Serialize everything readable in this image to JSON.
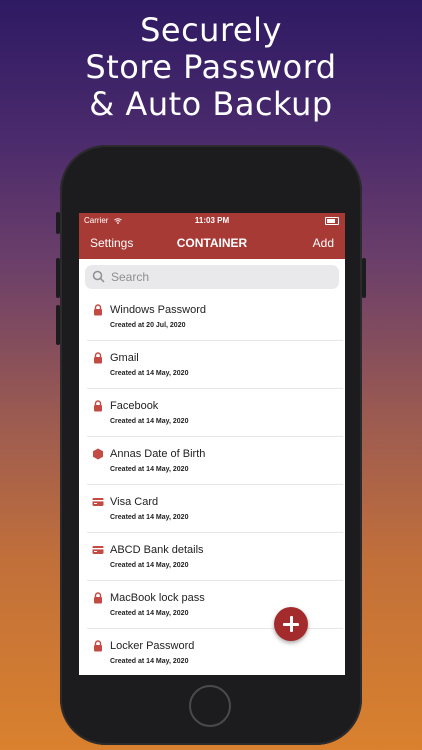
{
  "headline": {
    "line1": "Securely",
    "line2": "Store Password",
    "line3": "& Auto Backup"
  },
  "status_bar": {
    "carrier": "Carrier",
    "time": "11:03 PM"
  },
  "nav": {
    "left": "Settings",
    "title": "CONTAINER",
    "right": "Add"
  },
  "search": {
    "placeholder": "Search"
  },
  "items": [
    {
      "name": "Windows Password",
      "date": "Created at 20 Jul, 2020",
      "icon": "lock-icon"
    },
    {
      "name": "Gmail",
      "date": "Created at 14 May, 2020",
      "icon": "lock-icon"
    },
    {
      "name": "Facebook",
      "date": "Created at 14 May, 2020",
      "icon": "lock-icon"
    },
    {
      "name": "Annas Date of Birth",
      "date": "Created at 14 May, 2020",
      "icon": "hexagon-icon"
    },
    {
      "name": "Visa Card",
      "date": "Created at 14 May, 2020",
      "icon": "card-icon"
    },
    {
      "name": "ABCD Bank details",
      "date": "Created at 14 May, 2020",
      "icon": "card-icon"
    },
    {
      "name": "MacBook lock pass",
      "date": "Created at 14 May, 2020",
      "icon": "lock-icon"
    },
    {
      "name": "Locker Password",
      "date": "Created at 14 May, 2020",
      "icon": "lock-icon"
    }
  ],
  "colors": {
    "accent": "#a83a35",
    "icon": "#c44a44",
    "fab": "#a32b2b"
  }
}
